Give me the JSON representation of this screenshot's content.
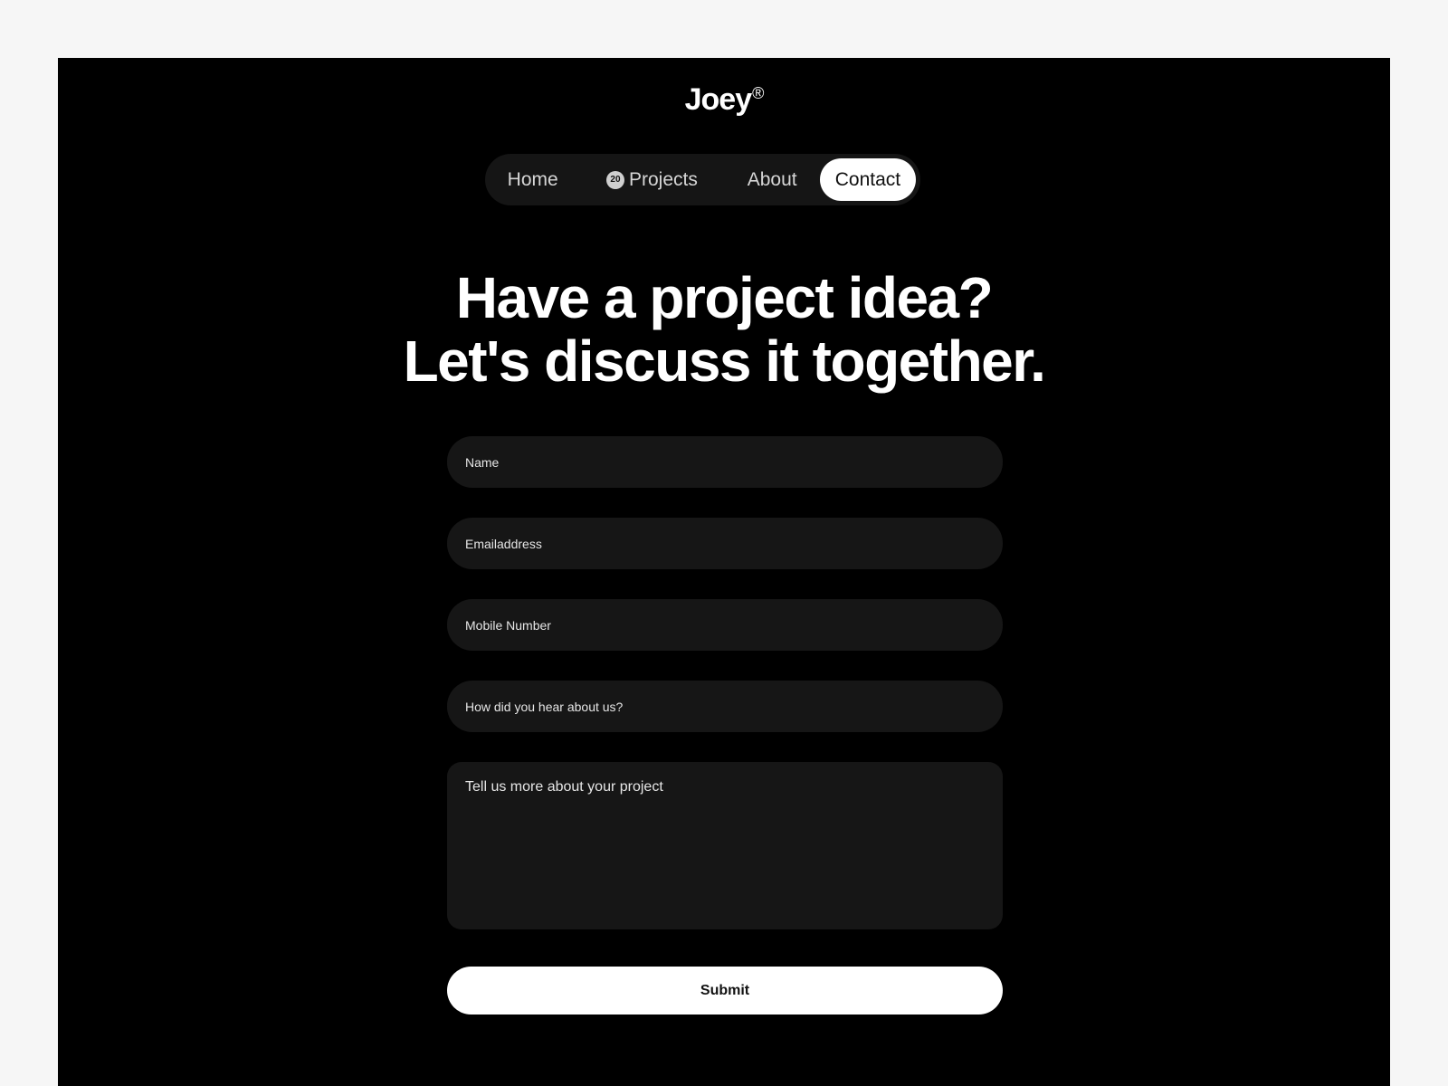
{
  "brand": {
    "name": "Joey",
    "mark": "®"
  },
  "nav": {
    "items": [
      {
        "label": "Home",
        "active": false
      },
      {
        "label": "Projects",
        "badge": "20",
        "active": false
      },
      {
        "label": "About",
        "active": false
      },
      {
        "label": "Contact",
        "active": true
      }
    ]
  },
  "hero": {
    "line1": "Have a project idea?",
    "line2": "Let's discuss it together."
  },
  "form": {
    "name_placeholder": "Name",
    "email_placeholder": "Emailaddress",
    "mobile_placeholder": "Mobile Number",
    "source_placeholder": "How did you hear about us?",
    "message_placeholder": "Tell us more about your project",
    "submit_label": "Submit"
  },
  "colors": {
    "page_background": "#f6f6f6",
    "frame_background": "#000000",
    "field_background": "#161616",
    "active_pill": "#ffffff"
  }
}
